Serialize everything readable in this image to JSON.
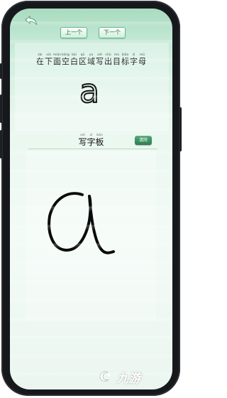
{
  "header": {
    "back_icon": "undo-arrow-icon",
    "prev_label": "上一个",
    "next_label": "下一个"
  },
  "instruction": {
    "chars": [
      {
        "py": "zài",
        "hz": "在"
      },
      {
        "py": "xià",
        "hz": "下"
      },
      {
        "py": "miàn",
        "hz": "面"
      },
      {
        "py": "kòng",
        "hz": "空"
      },
      {
        "py": "bái",
        "hz": "白"
      },
      {
        "py": "qū",
        "hz": "区"
      },
      {
        "py": "yù",
        "hz": "域"
      },
      {
        "py": "xiě",
        "hz": "写"
      },
      {
        "py": "chū",
        "hz": "出"
      },
      {
        "py": "mù",
        "hz": "目"
      },
      {
        "py": "biāo",
        "hz": "标"
      },
      {
        "py": "zì",
        "hz": "字"
      },
      {
        "py": "mǔ",
        "hz": "母"
      }
    ],
    "target_letter": "a"
  },
  "board": {
    "title_chars": [
      {
        "py": "xiě",
        "hz": "写"
      },
      {
        "py": "zì",
        "hz": "字"
      },
      {
        "py": "bǎn",
        "hz": "板"
      }
    ],
    "clear_label": "清除",
    "drawn_letter": "a"
  },
  "watermark": {
    "text": "九游",
    "logo_icon": "jiuyou-logo-icon"
  },
  "colors": {
    "accent": "#2e7d52",
    "background_top": "#a9dbbf",
    "background_bottom": "#f3fbf6"
  }
}
